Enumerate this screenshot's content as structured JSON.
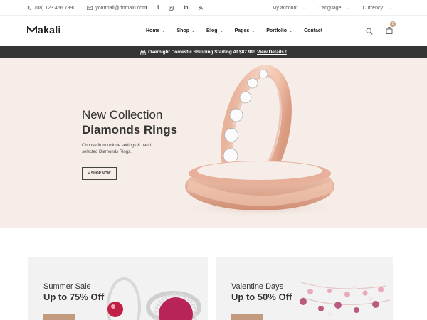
{
  "topbar": {
    "phone": "(08) 123 456 7890",
    "email": "yourmail@domain.com",
    "socials": [
      "facebook-icon",
      "twitter-icon",
      "instagram-icon",
      "linkedin-icon",
      "rss-icon"
    ],
    "my_account": "My account",
    "language": "Language",
    "currency": "Currency"
  },
  "header": {
    "logo": "akali",
    "nav": [
      "Home",
      "Shop",
      "Blog",
      "Pages",
      "Portfolio",
      "Contact"
    ],
    "cart_count": "0"
  },
  "promo": {
    "text": "Overnight Domestic Shipping Starting At $87.99!",
    "link": "View Details !"
  },
  "hero": {
    "subtitle": "New Collection",
    "title": "Diamonds Rings",
    "description": "Choose from unique settings & hand selected Diamonds Rings.",
    "button": "+ SHOP NOW"
  },
  "banners": [
    {
      "line1": "Summer Sale",
      "line2": "Up to 75% Off"
    },
    {
      "line1": "Valentine Days",
      "line2": "Up to 50% Off"
    }
  ],
  "colors": {
    "accent": "#c8a17e",
    "promo_bg": "#353535",
    "hero_bg": "#f6ede8"
  }
}
